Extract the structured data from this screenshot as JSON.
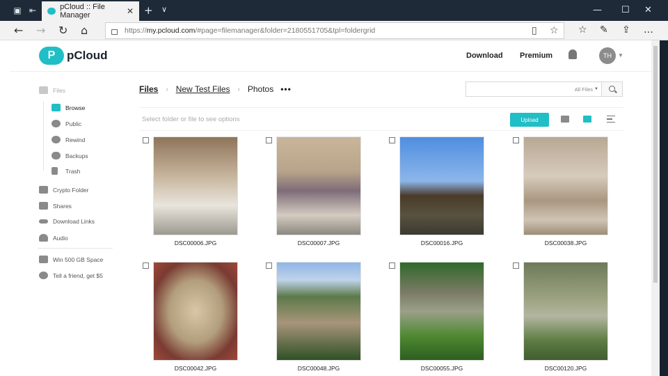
{
  "browser": {
    "tab_title": "pCloud :: File Manager",
    "url_prefix": "https://",
    "url_domain": "my.pcloud.com",
    "url_rest": "/#page=filemanager&folder=2180551705&tpl=foldergrid"
  },
  "header": {
    "logo_letter": "P",
    "logo_text": "pCloud",
    "download_label": "Download",
    "premium_label": "Premium",
    "avatar_initials": "TH"
  },
  "sidebar": {
    "files": "Files",
    "browse": "Browse",
    "public": "Public",
    "rewind": "Rewind",
    "backups": "Backups",
    "trash": "Trash",
    "crypto": "Crypto Folder",
    "shares": "Shares",
    "download_links": "Download Links",
    "audio": "Audio",
    "win": "Win 500 GB Space",
    "tell": "Tell a friend, get $5"
  },
  "breadcrumb": {
    "items": [
      "Files",
      "New Test Files",
      "Photos"
    ],
    "more": "•••"
  },
  "search": {
    "filter": "All Files"
  },
  "toolbar": {
    "hint": "Select folder or file to see options",
    "upload": "Upload"
  },
  "files": [
    "DSC00006.JPG",
    "DSC00007.JPG",
    "DSC00016.JPG",
    "DSC00038.JPG",
    "DSC00042.JPG",
    "DSC00048.JPG",
    "DSC00055.JPG",
    "DSC00120.JPG"
  ],
  "colors": {
    "accent": "#20bec6",
    "titlebar": "#1e2a38"
  }
}
